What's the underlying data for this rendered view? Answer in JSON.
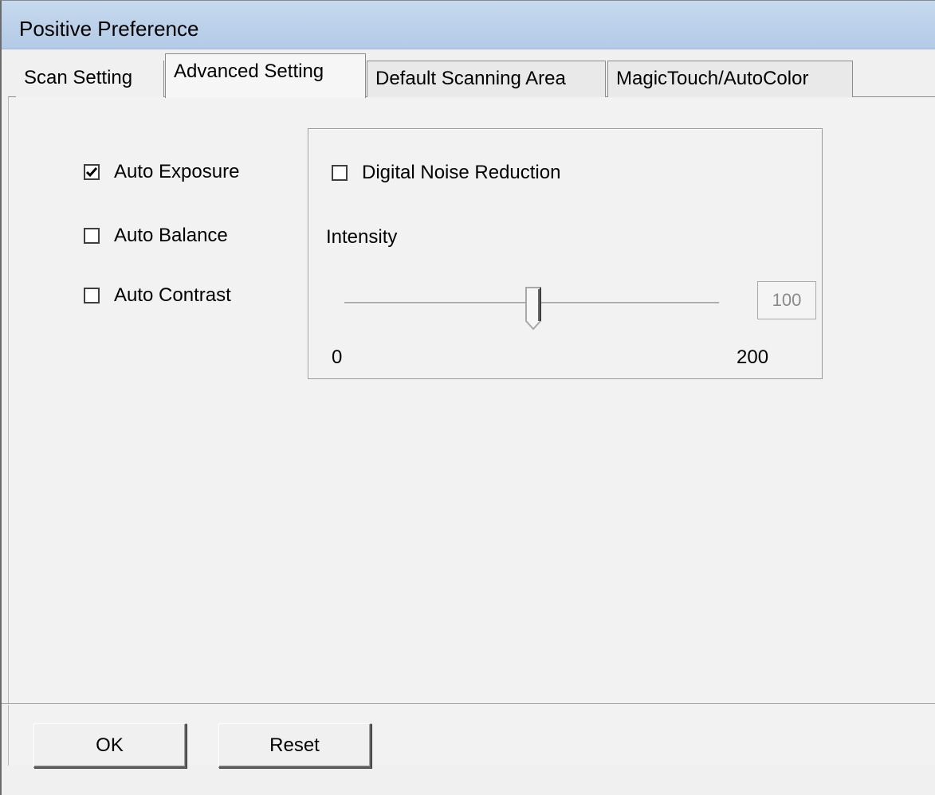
{
  "window": {
    "title": "Positive Preference"
  },
  "tabs": [
    {
      "label": "Scan Setting",
      "active": false
    },
    {
      "label": "Advanced Setting",
      "active": true
    },
    {
      "label": "Default Scanning Area",
      "active": false
    },
    {
      "label": "MagicTouch/AutoColor",
      "active": false
    }
  ],
  "options": {
    "auto_exposure": {
      "label": "Auto Exposure",
      "checked": true
    },
    "auto_balance": {
      "label": "Auto Balance",
      "checked": false
    },
    "auto_contrast": {
      "label": "Auto Contrast",
      "checked": false
    }
  },
  "noise_reduction": {
    "checkbox": {
      "label": "Digital Noise Reduction",
      "checked": false
    },
    "intensity_label": "Intensity",
    "slider": {
      "value": "100",
      "min": "0",
      "max": "200",
      "enabled": false
    }
  },
  "buttons": {
    "ok": "OK",
    "reset": "Reset"
  },
  "colors": {
    "titlebar": "#c6d9ee",
    "window_bg": "#f0f0f0",
    "disabled_text": "#8a8a8a"
  }
}
